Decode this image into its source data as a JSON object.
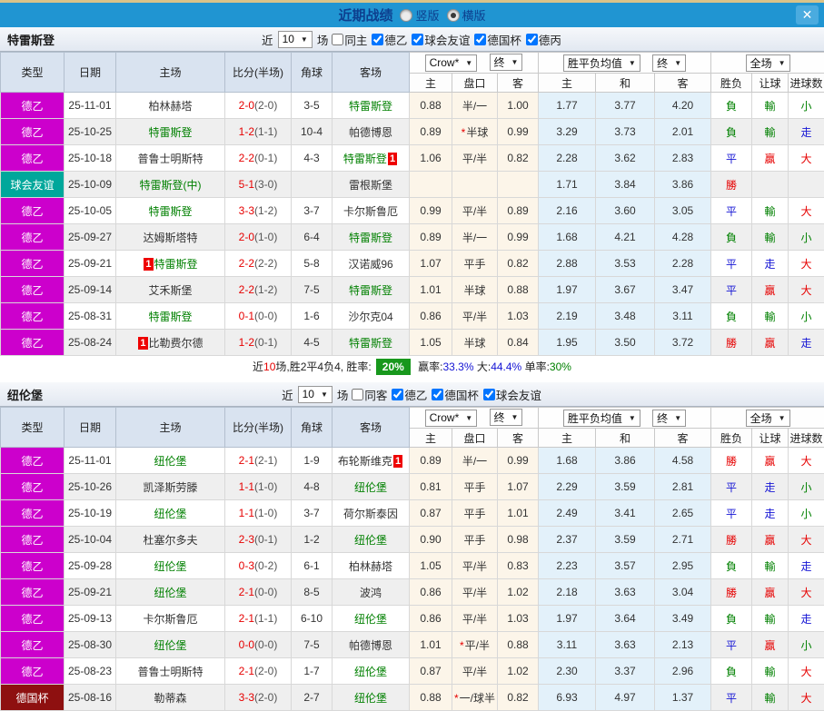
{
  "titlebar": {
    "title": "近期战绩",
    "radio_vertical": "竖版",
    "radio_horizontal": "横版",
    "selected": "横版"
  },
  "icons": {
    "caret": "▼",
    "close": "✕",
    "star": "*"
  },
  "league_colors": {
    "德乙": "#cc00cc",
    "球会友谊": "#00a79b",
    "德国杯": "#8e1010",
    "德丙": "#cc00cc"
  },
  "result_colors": {
    "勝": "#e60000",
    "負": "#008000",
    "平": "#1414d4",
    "贏": "#e60000",
    "輸": "#008000",
    "走": "#1414d4",
    "大": "#e60000",
    "小": "#008000"
  },
  "sections": [
    {
      "team": "特雷斯登",
      "filters": {
        "near": "近",
        "count": "10",
        "games": "场",
        "same": "同主",
        "leagues": [
          "德乙",
          "球会友谊",
          "德国杯",
          "德丙"
        ]
      },
      "dropdowns": {
        "company": "Crow*",
        "final1": "终",
        "avg": "胜平负均值",
        "final2": "终",
        "scope": "全场"
      },
      "columns": [
        "类型",
        "日期",
        "主场",
        "比分(半场)",
        "角球",
        "客场"
      ],
      "subcolumns": [
        "主",
        "盘口",
        "客",
        "主",
        "和",
        "客",
        "胜负",
        "让球",
        "进球数"
      ],
      "rows": [
        {
          "type": "德乙",
          "date": "25-11-01",
          "home": {
            "text": "柏林赫塔",
            "green": false
          },
          "score": "2-0",
          "half": "(2-0)",
          "corner": "3-5",
          "away": {
            "text": "特雷斯登",
            "green": true
          },
          "h": "0.88",
          "hcap": "半/一",
          "star": false,
          "a": "1.00",
          "avg": [
            "1.77",
            "3.77",
            "4.20"
          ],
          "res": [
            "負",
            "輸",
            "小"
          ]
        },
        {
          "type": "德乙",
          "date": "25-10-25",
          "home": {
            "text": "特雷斯登",
            "green": true
          },
          "score": "1-2",
          "half": "(1-1)",
          "corner": "10-4",
          "away": {
            "text": "帕德博恩",
            "green": false
          },
          "h": "0.89",
          "hcap": "半球",
          "star": true,
          "a": "0.99",
          "avg": [
            "3.29",
            "3.73",
            "2.01"
          ],
          "res": [
            "負",
            "輸",
            "走"
          ]
        },
        {
          "type": "德乙",
          "date": "25-10-18",
          "home": {
            "text": "普鲁士明斯特",
            "green": false
          },
          "score": "2-2",
          "half": "(0-1)",
          "corner": "4-3",
          "away": {
            "text": "特雷斯登",
            "green": true,
            "badge": "1",
            "badge_side": "right"
          },
          "h": "1.06",
          "hcap": "平/半",
          "star": false,
          "a": "0.82",
          "avg": [
            "2.28",
            "3.62",
            "2.83"
          ],
          "res": [
            "平",
            "贏",
            "大"
          ]
        },
        {
          "type": "球会友谊",
          "date": "25-10-09",
          "home": {
            "text": "特雷斯登(中)",
            "green": true
          },
          "score": "5-1",
          "half": "(3-0)",
          "corner": "",
          "away": {
            "text": "雷根斯堡",
            "green": false
          },
          "h": "",
          "hcap": "",
          "star": false,
          "a": "",
          "avg": [
            "1.71",
            "3.84",
            "3.86"
          ],
          "res": [
            "勝",
            "",
            ""
          ]
        },
        {
          "type": "德乙",
          "date": "25-10-05",
          "home": {
            "text": "特雷斯登",
            "green": true
          },
          "score": "3-3",
          "half": "(1-2)",
          "corner": "3-7",
          "away": {
            "text": "卡尔斯鲁厄",
            "green": false
          },
          "h": "0.99",
          "hcap": "平/半",
          "star": false,
          "a": "0.89",
          "avg": [
            "2.16",
            "3.60",
            "3.05"
          ],
          "res": [
            "平",
            "輸",
            "大"
          ]
        },
        {
          "type": "德乙",
          "date": "25-09-27",
          "home": {
            "text": "达姆斯塔特",
            "green": false
          },
          "score": "2-0",
          "half": "(1-0)",
          "corner": "6-4",
          "away": {
            "text": "特雷斯登",
            "green": true
          },
          "h": "0.89",
          "hcap": "半/一",
          "star": false,
          "a": "0.99",
          "avg": [
            "1.68",
            "4.21",
            "4.28"
          ],
          "res": [
            "負",
            "輸",
            "小"
          ]
        },
        {
          "type": "德乙",
          "date": "25-09-21",
          "home": {
            "text": "特雷斯登",
            "green": true,
            "badge": "1",
            "badge_side": "left"
          },
          "score": "2-2",
          "half": "(2-2)",
          "corner": "5-8",
          "away": {
            "text": "汉诺威96",
            "green": false
          },
          "h": "1.07",
          "hcap": "平手",
          "star": false,
          "a": "0.82",
          "avg": [
            "2.88",
            "3.53",
            "2.28"
          ],
          "res": [
            "平",
            "走",
            "大"
          ]
        },
        {
          "type": "德乙",
          "date": "25-09-14",
          "home": {
            "text": "艾禾斯堡",
            "green": false
          },
          "score": "2-2",
          "half": "(1-2)",
          "corner": "7-5",
          "away": {
            "text": "特雷斯登",
            "green": true
          },
          "h": "1.01",
          "hcap": "半球",
          "star": false,
          "a": "0.88",
          "avg": [
            "1.97",
            "3.67",
            "3.47"
          ],
          "res": [
            "平",
            "贏",
            "大"
          ]
        },
        {
          "type": "德乙",
          "date": "25-08-31",
          "home": {
            "text": "特雷斯登",
            "green": true
          },
          "score": "0-1",
          "half": "(0-0)",
          "corner": "1-6",
          "away": {
            "text": "沙尔克04",
            "green": false
          },
          "h": "0.86",
          "hcap": "平/半",
          "star": false,
          "a": "1.03",
          "avg": [
            "2.19",
            "3.48",
            "3.11"
          ],
          "res": [
            "負",
            "輸",
            "小"
          ]
        },
        {
          "type": "德乙",
          "date": "25-08-24",
          "home": {
            "text": "比勒费尔德",
            "green": false,
            "badge": "1",
            "badge_side": "left"
          },
          "score": "1-2",
          "half": "(0-1)",
          "corner": "4-5",
          "away": {
            "text": "特雷斯登",
            "green": true
          },
          "h": "1.05",
          "hcap": "半球",
          "star": false,
          "a": "0.84",
          "avg": [
            "1.95",
            "3.50",
            "3.72"
          ],
          "res": [
            "勝",
            "贏",
            "走"
          ]
        }
      ],
      "summary": {
        "t1": "近",
        "n": "10",
        "t2": "场,胜2平4负4, 胜率:",
        "rate": "20%",
        "t3": "赢率:",
        "v3": "33.3%",
        "t4": "大:",
        "v4": "44.4%",
        "t5": "单率:",
        "v5": "30%"
      }
    },
    {
      "team": "纽伦堡",
      "filters": {
        "near": "近",
        "count": "10",
        "games": "场",
        "same": "同客",
        "leagues": [
          "德乙",
          "德国杯",
          "球会友谊"
        ]
      },
      "dropdowns": {
        "company": "Crow*",
        "final1": "终",
        "avg": "胜平负均值",
        "final2": "终",
        "scope": "全场"
      },
      "columns": [
        "类型",
        "日期",
        "主场",
        "比分(半场)",
        "角球",
        "客场"
      ],
      "subcolumns": [
        "主",
        "盘口",
        "客",
        "主",
        "和",
        "客",
        "胜负",
        "让球",
        "进球数"
      ],
      "rows": [
        {
          "type": "德乙",
          "date": "25-11-01",
          "home": {
            "text": "纽伦堡",
            "green": true
          },
          "score": "2-1",
          "half": "(2-1)",
          "corner": "1-9",
          "away": {
            "text": "布轮斯维克",
            "green": false,
            "badge": "1",
            "badge_side": "right"
          },
          "h": "0.89",
          "hcap": "半/一",
          "star": false,
          "a": "0.99",
          "avg": [
            "1.68",
            "3.86",
            "4.58"
          ],
          "res": [
            "勝",
            "贏",
            "大"
          ]
        },
        {
          "type": "德乙",
          "date": "25-10-26",
          "home": {
            "text": "凯泽斯劳滕",
            "green": false
          },
          "score": "1-1",
          "half": "(1-0)",
          "corner": "4-8",
          "away": {
            "text": "纽伦堡",
            "green": true
          },
          "h": "0.81",
          "hcap": "平手",
          "star": false,
          "a": "1.07",
          "avg": [
            "2.29",
            "3.59",
            "2.81"
          ],
          "res": [
            "平",
            "走",
            "小"
          ]
        },
        {
          "type": "德乙",
          "date": "25-10-19",
          "home": {
            "text": "纽伦堡",
            "green": true
          },
          "score": "1-1",
          "half": "(1-0)",
          "corner": "3-7",
          "away": {
            "text": "荷尔斯泰因",
            "green": false
          },
          "h": "0.87",
          "hcap": "平手",
          "star": false,
          "a": "1.01",
          "avg": [
            "2.49",
            "3.41",
            "2.65"
          ],
          "res": [
            "平",
            "走",
            "小"
          ]
        },
        {
          "type": "德乙",
          "date": "25-10-04",
          "home": {
            "text": "杜塞尔多夫",
            "green": false
          },
          "score": "2-3",
          "half": "(0-1)",
          "corner": "1-2",
          "away": {
            "text": "纽伦堡",
            "green": true
          },
          "h": "0.90",
          "hcap": "平手",
          "star": false,
          "a": "0.98",
          "avg": [
            "2.37",
            "3.59",
            "2.71"
          ],
          "res": [
            "勝",
            "贏",
            "大"
          ]
        },
        {
          "type": "德乙",
          "date": "25-09-28",
          "home": {
            "text": "纽伦堡",
            "green": true
          },
          "score": "0-3",
          "half": "(0-2)",
          "corner": "6-1",
          "away": {
            "text": "柏林赫塔",
            "green": false
          },
          "h": "1.05",
          "hcap": "平/半",
          "star": false,
          "a": "0.83",
          "avg": [
            "2.23",
            "3.57",
            "2.95"
          ],
          "res": [
            "負",
            "輸",
            "走"
          ]
        },
        {
          "type": "德乙",
          "date": "25-09-21",
          "home": {
            "text": "纽伦堡",
            "green": true
          },
          "score": "2-1",
          "half": "(0-0)",
          "corner": "8-5",
          "away": {
            "text": "波鸿",
            "green": false
          },
          "h": "0.86",
          "hcap": "平/半",
          "star": false,
          "a": "1.02",
          "avg": [
            "2.18",
            "3.63",
            "3.04"
          ],
          "res": [
            "勝",
            "贏",
            "大"
          ]
        },
        {
          "type": "德乙",
          "date": "25-09-13",
          "home": {
            "text": "卡尔斯鲁厄",
            "green": false
          },
          "score": "2-1",
          "half": "(1-1)",
          "corner": "6-10",
          "away": {
            "text": "纽伦堡",
            "green": true
          },
          "h": "0.86",
          "hcap": "平/半",
          "star": false,
          "a": "1.03",
          "avg": [
            "1.97",
            "3.64",
            "3.49"
          ],
          "res": [
            "負",
            "輸",
            "走"
          ]
        },
        {
          "type": "德乙",
          "date": "25-08-30",
          "home": {
            "text": "纽伦堡",
            "green": true
          },
          "score": "0-0",
          "half": "(0-0)",
          "corner": "7-5",
          "away": {
            "text": "帕德博恩",
            "green": false
          },
          "h": "1.01",
          "hcap": "平/半",
          "star": true,
          "a": "0.88",
          "avg": [
            "3.11",
            "3.63",
            "2.13"
          ],
          "res": [
            "平",
            "贏",
            "小"
          ]
        },
        {
          "type": "德乙",
          "date": "25-08-23",
          "home": {
            "text": "普鲁士明斯特",
            "green": false
          },
          "score": "2-1",
          "half": "(2-0)",
          "corner": "1-7",
          "away": {
            "text": "纽伦堡",
            "green": true
          },
          "h": "0.87",
          "hcap": "平/半",
          "star": false,
          "a": "1.02",
          "avg": [
            "2.30",
            "3.37",
            "2.96"
          ],
          "res": [
            "負",
            "輸",
            "大"
          ]
        },
        {
          "type": "德国杯",
          "date": "25-08-16",
          "home": {
            "text": "勒蒂森",
            "green": false
          },
          "score": "3-3",
          "half": "(2-0)",
          "corner": "2-7",
          "away": {
            "text": "纽伦堡",
            "green": true
          },
          "h": "0.88",
          "hcap": "一/球半",
          "star": true,
          "a": "0.82",
          "avg": [
            "6.93",
            "4.97",
            "1.37"
          ],
          "res": [
            "平",
            "輸",
            "大"
          ]
        }
      ],
      "summary": null
    }
  ]
}
